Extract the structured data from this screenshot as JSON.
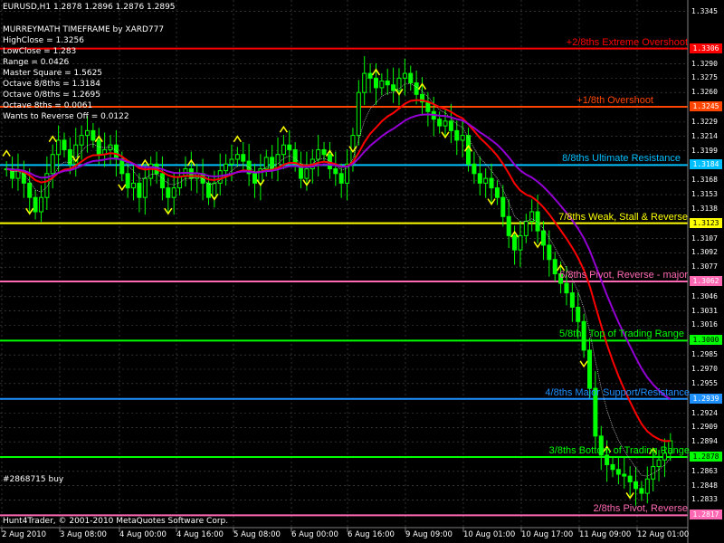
{
  "header": {
    "symbol_line": "EURUSD,H1  1.2878 1.2896 1.2876 1.2895",
    "indicator_title": "MURREYMATH TIMEFRAME by XARD777",
    "stats": [
      "HighClose = 1.3256",
      "LowClose = 1.283",
      "Range = 0.0426",
      "Master Square = 1.5625",
      "Octave 8/8ths = 1.3184",
      "Octave 0/8ths = 1.2695",
      "Octave 8ths = 0.0061",
      "Wants to Reverse Off = 0.0122"
    ]
  },
  "order_label": "#2868715 buy",
  "copyright": "Hunt4Trader, © 2001-2010 MetaQuotes Software Corp.",
  "levels": [
    {
      "price": 1.3306,
      "tag": "1.3306",
      "label": "+2/8ths Extreme Overshoot",
      "color": "#ff0000",
      "tag_color": "#ff0000",
      "tag_text": "#ffffff",
      "label_right": 760
    },
    {
      "price": 1.3245,
      "tag": "1.3245",
      "label": "+1/8th Overshoot",
      "color": "#ff4500",
      "tag_color": "#ff4500",
      "tag_text": "#ffffff",
      "label_right": 722
    },
    {
      "price": 1.3184,
      "tag": "1.3184",
      "label": "8/8ths Ultimate Resistance",
      "color": "#00bfff",
      "tag_color": "#00bfff",
      "tag_text": "#ffffff",
      "label_right": 752
    },
    {
      "price": 1.3123,
      "tag": "1.3123",
      "label": "7/8ths Weak, Stall & Reverse",
      "color": "#ffff00",
      "tag_color": "#ffff00",
      "tag_text": "#000000",
      "label_right": 760
    },
    {
      "price": 1.3062,
      "tag": "1.3062",
      "label": "6/8ths Pivot, Reverse - major",
      "color": "#ff69b4",
      "tag_color": "#ff69b4",
      "tag_text": "#ffffff",
      "label_right": 760
    },
    {
      "price": 1.3,
      "tag": "1.3000",
      "label": "5/8ths Top of Trading Range",
      "color": "#00ff00",
      "tag_color": "#00ff00",
      "tag_text": "#000000",
      "label_right": 756
    },
    {
      "price": 1.2939,
      "tag": "1.2939",
      "label": "4/8ths Major Support/Resistance",
      "color": "#1e90ff",
      "tag_color": "#1e90ff",
      "tag_text": "#ffffff",
      "label_right": 762
    },
    {
      "price": 1.2878,
      "tag": "1.2878",
      "label": "3/8ths Bottom of Trading Range",
      "color": "#00ff00",
      "tag_color": "#00ff00",
      "tag_text": "#000000",
      "label_right": 762
    },
    {
      "price": 1.2817,
      "tag": "1.2817",
      "label": "2/8ths Pivot, Reverse",
      "color": "#ff69b4",
      "tag_color": "#ff69b4",
      "tag_text": "#ffffff",
      "label_right": 760
    }
  ],
  "price_axis": [
    "1.3345",
    "1.3290",
    "1.3275",
    "1.3260",
    "1.3229",
    "1.3214",
    "1.3199",
    "1.3168",
    "1.3153",
    "1.3138",
    "1.3107",
    "1.3092",
    "1.3077",
    "1.3046",
    "1.3031",
    "1.3016",
    "1.2985",
    "1.2970",
    "1.2955",
    "1.2924",
    "1.2909",
    "1.2894",
    "1.2863",
    "1.2848",
    "1.2833"
  ],
  "time_axis": [
    "2 Aug 2010",
    "3 Aug 08:00",
    "4 Aug 00:00",
    "4 Aug 16:00",
    "5 Aug 08:00",
    "6 Aug 00:00",
    "6 Aug 16:00",
    "9 Aug 09:00",
    "10 Aug 01:00",
    "10 Aug 17:00",
    "11 Aug 09:00",
    "12 Aug 01:00"
  ],
  "colors": {
    "background": "#000000",
    "candle": "#00ff00",
    "ma_fast": "#ff0000",
    "ma_slow": "#9400d3",
    "grid": "#808080",
    "arrow": "#ffff00"
  },
  "chart_data": {
    "type": "candlestick",
    "symbol": "EURUSD",
    "timeframe": "H1",
    "last_bar": {
      "open": 1.2878,
      "high": 1.2896,
      "low": 1.2876,
      "close": 1.2895
    },
    "ylim": [
      1.2805,
      1.3355
    ],
    "closes": [
      1.318,
      1.317,
      1.3178,
      1.3165,
      1.315,
      1.3135,
      1.315,
      1.3175,
      1.3195,
      1.321,
      1.32,
      1.3185,
      1.3205,
      1.3215,
      1.322,
      1.321,
      1.3195,
      1.32,
      1.3205,
      1.319,
      1.3175,
      1.316,
      1.3165,
      1.315,
      1.317,
      1.3185,
      1.3175,
      1.316,
      1.315,
      1.316,
      1.3172,
      1.318,
      1.317,
      1.3175,
      1.3165,
      1.315,
      1.3165,
      1.3178,
      1.3185,
      1.319,
      1.3195,
      1.3188,
      1.3175,
      1.3165,
      1.318,
      1.3192,
      1.318,
      1.3195,
      1.3205,
      1.32,
      1.3185,
      1.317,
      1.318,
      1.319,
      1.32,
      1.3195,
      1.318,
      1.3175,
      1.3165,
      1.3185,
      1.3215,
      1.326,
      1.328,
      1.3275,
      1.3265,
      1.3272,
      1.3268,
      1.3262,
      1.3275,
      1.328,
      1.327,
      1.3258,
      1.325,
      1.324,
      1.3232,
      1.3225,
      1.323,
      1.322,
      1.321,
      1.3215,
      1.3185,
      1.3175,
      1.3165,
      1.317,
      1.316,
      1.315,
      1.313,
      1.311,
      1.3095,
      1.311,
      1.3125,
      1.3135,
      1.3115,
      1.31,
      1.3085,
      1.307,
      1.306,
      1.305,
      1.3035,
      1.302,
      1.299,
      1.295,
      1.29,
      1.288,
      1.287,
      1.2865,
      1.286,
      1.2858,
      1.2852,
      1.2845,
      1.284,
      1.2855,
      1.2868,
      1.2875,
      1.2882,
      1.2895
    ]
  }
}
